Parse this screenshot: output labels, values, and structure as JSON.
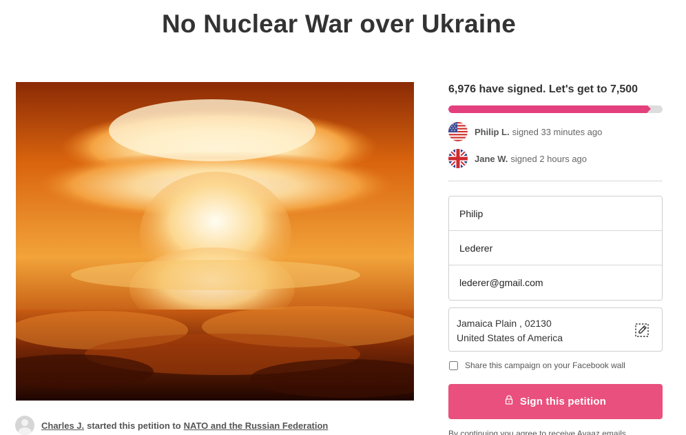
{
  "page": {
    "title": "No Nuclear War over Ukraine"
  },
  "hero": {
    "icon": "mushroom-cloud-photo"
  },
  "starter": {
    "name": "Charles J.",
    "text": "started this petition to",
    "target": "NATO and the Russian Federation"
  },
  "progress": {
    "headline": "6,976 have signed. Let's get to 7,500",
    "signed": 6976,
    "goal": 7500,
    "fraction": 0.9301,
    "color": "#e3407d"
  },
  "signers": [
    {
      "name": "Philip L.",
      "text": "signed 33 minutes ago",
      "flag": "us-flag-icon"
    },
    {
      "name": "Jane W.",
      "text": "signed 2 hours ago",
      "flag": "uk-flag-icon"
    }
  ],
  "form": {
    "first_name": "Philip",
    "last_name": "Lederer",
    "email": "lederer@gmail.com",
    "address_line1": "Jamaica Plain , 02130",
    "address_line2": "United States of America",
    "share_label": "Share this campaign on your Facebook wall",
    "share_checked": false
  },
  "cta": {
    "label": "Sign this petition",
    "color": "#e9507d"
  },
  "legal": {
    "text": "By continuing you agree to receive Avaaz emails"
  }
}
